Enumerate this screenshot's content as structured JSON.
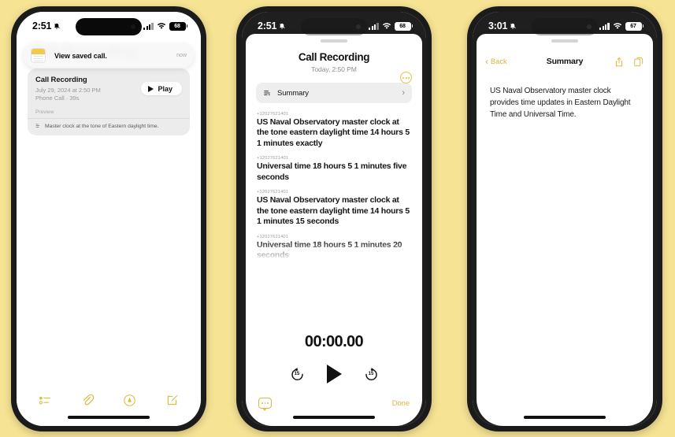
{
  "background_color": "#f6e394",
  "accent_color": "#dcba3c",
  "phone1": {
    "status": {
      "time": "2:51",
      "battery": "68",
      "alarm_icon": "bell-slash-icon",
      "signal_icon": "cellular-bars-icon",
      "wifi_icon": "wifi-icon"
    },
    "banner": {
      "app_icon": "notes-app-icon",
      "text": "View saved call.",
      "time": "now"
    },
    "page_title": "Call Recording",
    "card": {
      "title": "Call Recording",
      "date": "July 29, 2024 at 2:50 PM",
      "meta": "Phone Call · 39s",
      "play_label": "Play",
      "preview_label": "Preview",
      "preview_icon": "transcript-icon",
      "preview_text": "Master clock at the tone of Eastern daylight time."
    },
    "toolbar": [
      {
        "name": "checklist-icon"
      },
      {
        "name": "attachment-icon"
      },
      {
        "name": "audio-record-icon"
      },
      {
        "name": "compose-icon"
      }
    ]
  },
  "phone2": {
    "status": {
      "time": "2:51",
      "battery": "68"
    },
    "sheet": {
      "title": "Call Recording",
      "subtitle": "Today, 2:50 PM",
      "more_icon": "more-ellipsis-icon",
      "summary_row": {
        "icon": "summary-icon",
        "label": "Summary",
        "chevron": "›"
      }
    },
    "transcript": [
      {
        "number": "+12027621401",
        "text": "US Naval Observatory master clock at the tone eastern daylight time 14 hours 5 1 minutes exactly"
      },
      {
        "number": "+12027621401",
        "text": "Universal time 18 hours 5 1 minutes five seconds"
      },
      {
        "number": "+12027621401",
        "text": "US Naval Observatory master clock at the tone eastern daylight time 14 hours 5 1 minutes 15 seconds"
      },
      {
        "number": "+12027621401",
        "text": "Universal time 18 hours 5 1 minutes 20 seconds"
      }
    ],
    "player": {
      "timecode": "00:00.00",
      "skip_back_label": "15",
      "skip_forward_label": "15",
      "play_icon": "play-icon"
    },
    "bottom": {
      "transcript_icon": "transcript-bubble-icon",
      "done_label": "Done"
    }
  },
  "phone3": {
    "status": {
      "time": "3:01",
      "battery": "67"
    },
    "navbar": {
      "back_label": "Back",
      "title": "Summary",
      "share_icon": "share-icon",
      "copy_icon": "copy-icon"
    },
    "summary_text": "US Naval Observatory master clock provides time updates in Eastern Daylight Time and Universal Time."
  }
}
